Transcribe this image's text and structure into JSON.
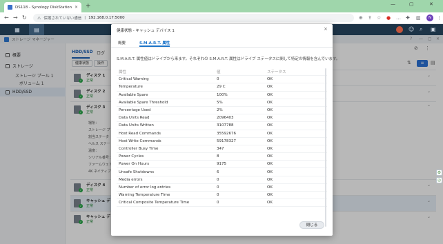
{
  "browser": {
    "tab_title": "DS118 - Synology DiskStation",
    "tab_close": "×",
    "new_tab": "+",
    "minimize": "—",
    "maximize": "▢",
    "close": "✕",
    "security_warning": "保護されていない通信",
    "url": "192.168.0.17:5000",
    "profile_initial": "N",
    "tab_bar_color": "#9fd6ab"
  },
  "dsm": {
    "bar_color": "#1d3447"
  },
  "app": {
    "title": "ストレージ マネージャー",
    "sidebar": {
      "overview": "概要",
      "storage": "ストレージ",
      "storage_pool": "ストレージ プール 1",
      "volume": "ボリューム 1",
      "hdd_ssd": "HDD/SSD"
    },
    "tabs": [
      "HDD/SSD",
      "ログ"
    ],
    "buttons": {
      "health_info": "健康状態",
      "action": "操作"
    },
    "disks": [
      {
        "name": "ディスク 1",
        "status": "正常"
      },
      {
        "name": "ディスク 2",
        "status": "正常"
      },
      {
        "name": "ディスク 3",
        "status": "正常"
      },
      {
        "name": "ディスク 4",
        "status": "正常"
      },
      {
        "name": "キャッシュ デ",
        "status": "正常"
      },
      {
        "name": "キャッシュ デ",
        "status": "正常"
      }
    ],
    "disk3_details": [
      "場所：",
      "ストレージ プ",
      "割当ステータ",
      "ヘルス ステー",
      "温度：",
      "シリアル番号：",
      "ファームウェア",
      "4K ネイティブ"
    ]
  },
  "modal": {
    "title": "健康状態 - キャッシュ デバイス 1",
    "close": "×",
    "tabs": [
      "概要",
      "S.M.A.R.T. 属性"
    ],
    "active_tab": 1,
    "description": "S.M.A.R.T. 属性値はドライブから来ます。それぞれの S.M.A.R.T. 属性はドライブ ステータスに関して特定の情報を含んでいます。",
    "columns": [
      "属性",
      "値",
      "ステータス"
    ],
    "rows": [
      [
        "Critical Warning",
        "0",
        "OK"
      ],
      [
        "Temperature",
        "29 C",
        "OK"
      ],
      [
        "Available Spare",
        "100%",
        "OK"
      ],
      [
        "Available Spare Threshold",
        "5%",
        "OK"
      ],
      [
        "Percentage Used",
        "2%",
        "OK"
      ],
      [
        "Data Units Read",
        "2096403",
        "OK"
      ],
      [
        "Data Units Written",
        "3107788",
        "OK"
      ],
      [
        "Host Read Commands",
        "35592676",
        "OK"
      ],
      [
        "Host Write Commands",
        "59178327",
        "OK"
      ],
      [
        "Controller Busy Time",
        "347",
        "OK"
      ],
      [
        "Power Cycles",
        "8",
        "OK"
      ],
      [
        "Power On Hours",
        "9175",
        "OK"
      ],
      [
        "Unsafe Shutdowns",
        "6",
        "OK"
      ],
      [
        "Media errors",
        "0",
        "OK"
      ],
      [
        "Number of error log entries",
        "0",
        "OK"
      ],
      [
        "Warning Temperature Time",
        "0",
        "OK"
      ],
      [
        "Critical Composite Temperature Time",
        "0",
        "OK"
      ]
    ],
    "close_button": "閉じる"
  }
}
